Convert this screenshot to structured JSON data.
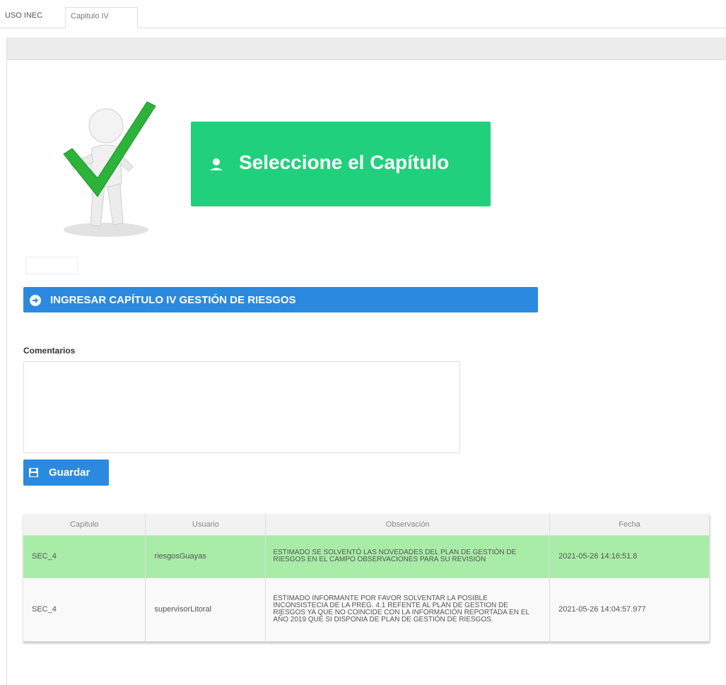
{
  "tabs": [
    {
      "label": "USO INEC"
    },
    {
      "label": "Capitulo IV"
    }
  ],
  "select_box": {
    "label": "Seleccione el Capítulo",
    "color": "#21d07d"
  },
  "ingresar": {
    "label": "INGRESAR CAPÍTULO IV GESTIÓN DE RIESGOS",
    "color": "#2b8ae0"
  },
  "comentarios": {
    "label": "Comentarios",
    "value": "",
    "placeholder": ""
  },
  "guardar": {
    "label": "Guardar"
  },
  "table": {
    "headers": [
      "Capitulo",
      "Usuario",
      "Observación",
      "Fecha"
    ],
    "rows": [
      {
        "capitulo": "SEC_4",
        "usuario": "riesgosGuayas",
        "observacion": "ESTIMADO SE SOLVENTÓ LAS NOVEDADES DEL PLAN DE GESTIÓN DE RIESGOS EN EL CAMPO OBSERVACIONES PARA SU REVISIÓN",
        "fecha": "2021-05-26 14:16:51.8",
        "highlight": "#a8eca8"
      },
      {
        "capitulo": "SEC_4",
        "usuario": "supervisorLitoral",
        "observacion": "ESTIMADO INFORMANTE POR FAVOR SOLVENTAR LA POSIBLE INCONSISTECIA DE LA PREG. 4.1 REFENTE AL PLAN DE GESTION DE RIESGOS YA QUE NO COINCIDE CON LA INFORMACIÓN REPORTADA EN EL AÑO 2019 QUE SI DISPONIA DE PLAN DE GESTIÓN DE RIESGOS.",
        "fecha": "2021-05-26 14:04:57.977"
      }
    ]
  },
  "icons": {
    "figure": "person-checkmark-illustration",
    "select": "user-icon",
    "ingresar": "arrow-right-icon",
    "guardar": "floppy-disk-icon"
  }
}
